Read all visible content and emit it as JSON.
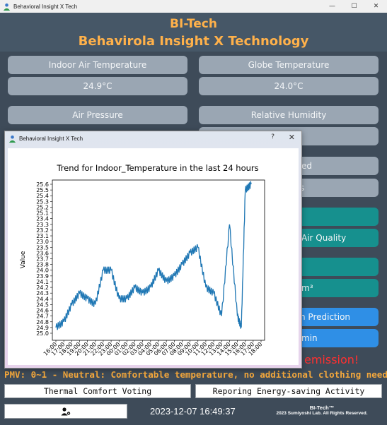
{
  "window": {
    "title": "Behavioral Insight X Tech",
    "icon": "person-app-icon"
  },
  "window_buttons": {
    "minimize": "—",
    "maximize": "☐",
    "close": "✕"
  },
  "header": {
    "line1": "BI-Tech",
    "line2": "Behavirola Insight X Technology"
  },
  "cards": {
    "indoor_temp_label": "Indoor Air Temperature",
    "indoor_temp_value": "24.9°C",
    "globe_temp_label": "Globe Temperature",
    "globe_temp_value": "24.0°C",
    "air_pressure_label": "Air Pressure",
    "relative_humidity_label": "Relative Humidity",
    "partial_right_1": "ed",
    "partial_right_2": "s",
    "partial_air_quality": "Air Quality",
    "partial_unit": "m³",
    "partial_prediction": "n Prediction",
    "partial_min": "min"
  },
  "emission_text": "emission!",
  "pmv_text": "PMV: 0~1 - Neutral: Comfortable temperature, no additional clothing needed.",
  "buttons": {
    "thermal_voting": "Thermal Comfort Voting",
    "energy_saving": "Reporing Energy-saving Activity"
  },
  "footer": {
    "datetime": "2023-12-07 16:49:37",
    "brand_line1": "BI-Tech™",
    "brand_line2": "2023 Sumiyoshi Lab. All Rights Reserved."
  },
  "dialog": {
    "title": "Behavioral Insight X Tech",
    "help": "?",
    "close": "✕"
  },
  "colors": {
    "background": "#3e4b59",
    "card": "#9aa6b3",
    "teal": "#16908e",
    "blue": "#2f8fe6",
    "accent_orange": "#ffb14a",
    "alert_red": "#ff3030",
    "line": "#1f77b4"
  },
  "chart_data": {
    "type": "line",
    "title": "Trend for Indoor_Temperature in the last 24 hours",
    "ylabel": "Value",
    "xlabel": "",
    "y_ticks": [
      "25.6",
      "25.5",
      "25.4",
      "25.3",
      "25.2",
      "25.1",
      "23.4",
      "23.3",
      "23.2",
      "23.1",
      "23.0",
      "23.5",
      "23.6",
      "23.7",
      "23.8",
      "24.0",
      "23.9",
      "24.1",
      "24.2",
      "24.3",
      "24.4",
      "24.5",
      "24.6",
      "24.7",
      "24.8",
      "24.9",
      "25.0"
    ],
    "x_ticks": [
      "16:00",
      "17:00",
      "18:00",
      "19:00",
      "20:00",
      "21:00",
      "22:00",
      "23:00",
      "00:00",
      "01:00",
      "02:00",
      "03:00",
      "04:00",
      "05:00",
      "06:00",
      "07:00",
      "08:00",
      "09:00",
      "10:00",
      "11:00",
      "12:00",
      "13:00",
      "14:00",
      "15:00",
      "16:00",
      "17:00",
      "18:00"
    ],
    "x": [
      "16:00",
      "17:00",
      "18:00",
      "19:00",
      "20:00",
      "21:00",
      "22:00",
      "23:00",
      "00:00",
      "01:00",
      "02:00",
      "03:00",
      "04:00",
      "05:00",
      "06:00",
      "07:00",
      "08:00",
      "09:00",
      "10:00",
      "11:00",
      "12:00",
      "13:00",
      "14:00",
      "15:00",
      "15:30",
      "16:00",
      "16:45"
    ],
    "series": [
      {
        "values": [
          "24.9",
          "24.8",
          "24.5",
          "24.3",
          "24.4",
          "24.5",
          "24.0",
          "24.0",
          "24.4",
          "24.4",
          "24.2",
          "24.3",
          "24.2",
          "24.0",
          "24.1",
          "23.9",
          "23.8",
          "23.6",
          "23.5",
          "24.2",
          "24.3",
          "24.7",
          "23.3",
          "24.7",
          "24.9",
          "25.5",
          "25.6"
        ]
      }
    ]
  }
}
